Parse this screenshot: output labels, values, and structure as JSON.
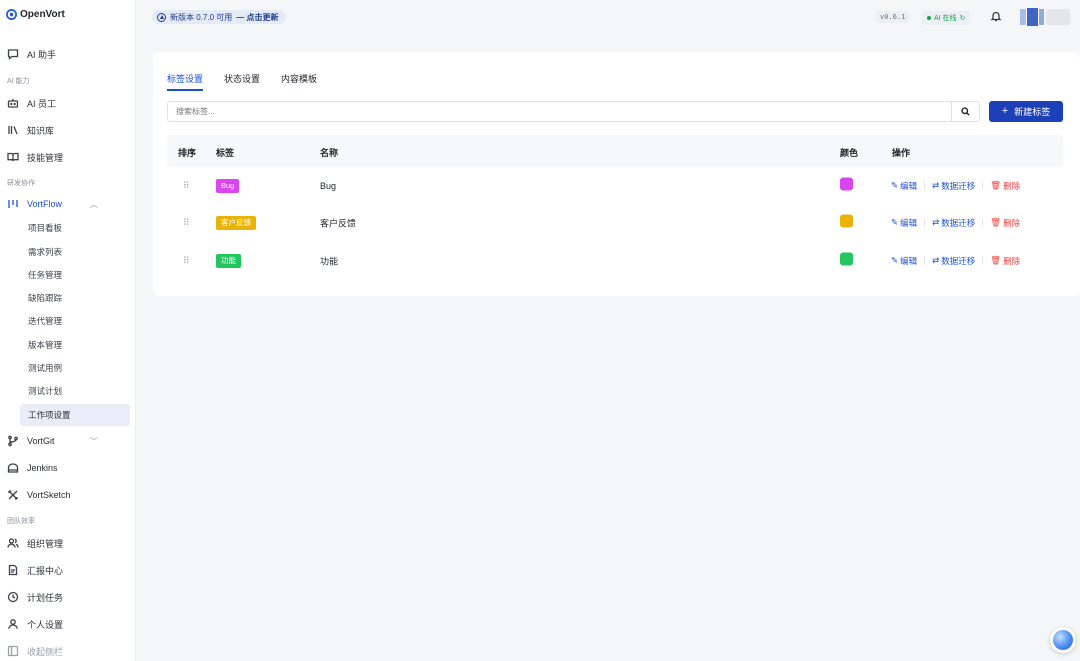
{
  "app": {
    "name": "OpenVort"
  },
  "topbar": {
    "update_text": "新版本 0.7.0 可用",
    "update_action": "— 点击更新",
    "version": "v0.6.1",
    "ai_status": "AI 在线"
  },
  "sidebar": {
    "ai_assistant": "AI 助手",
    "section_ai": "AI 能力",
    "ai_staff": "AI 员工",
    "knowledge": "知识库",
    "skills": "技能管理",
    "section_dev": "研发协作",
    "vortflow": "VortFlow",
    "vortflow_children": [
      "项目看板",
      "需求列表",
      "任务管理",
      "缺陷跟踪",
      "迭代管理",
      "版本管理",
      "测试用例",
      "测试计划",
      "工作项设置"
    ],
    "vortgit": "VortGit",
    "jenkins": "Jenkins",
    "vortsketch": "VortSketch",
    "section_team": "团队效率",
    "org": "组织管理",
    "reports": "汇报中心",
    "plans": "计划任务",
    "personal": "个人设置",
    "collapse": "收起侧栏"
  },
  "tabs": [
    "标签设置",
    "状态设置",
    "内容模板"
  ],
  "search": {
    "placeholder": "搜索标签..."
  },
  "new_button": "新建标签",
  "table": {
    "headers": {
      "order": "排序",
      "tag": "标签",
      "name": "名称",
      "color": "颜色",
      "actions": "操作"
    },
    "rows": [
      {
        "tag": "Bug",
        "name": "Bug",
        "color": "#d946ef"
      },
      {
        "tag": "客户反馈",
        "name": "客户反馈",
        "color": "#eab308"
      },
      {
        "tag": "功能",
        "name": "功能",
        "color": "#22c55e"
      }
    ],
    "actions": {
      "edit": "编辑",
      "migrate": "数据迁移",
      "delete": "删除"
    }
  },
  "colors": {
    "accent": "#1d4ed8",
    "danger": "#ef4444",
    "success": "#16a34a"
  }
}
